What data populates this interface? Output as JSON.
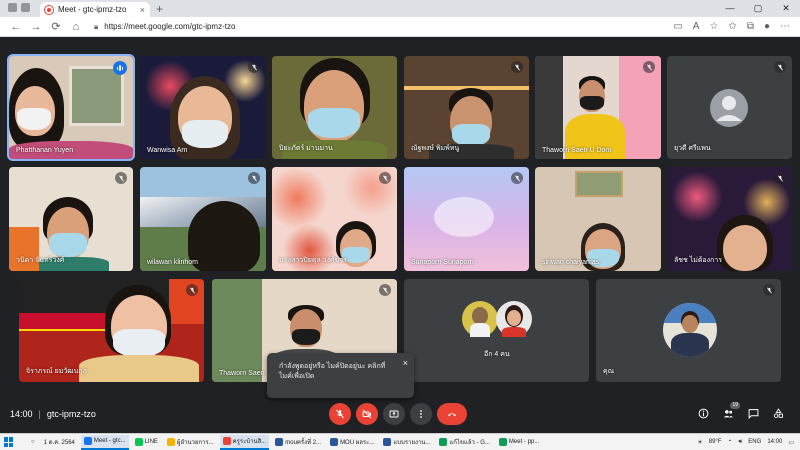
{
  "browser": {
    "tab_title": "Meet - gtc-ipmz-tzo",
    "url": "https://meet.google.com/gtc-ipmz-tzo"
  },
  "tiles": [
    {
      "name": "Phatthanan Yuyen",
      "speaking": true
    },
    {
      "name": "Wanwisa Am"
    },
    {
      "name": "ปิยะภัตร์ ม่านมาน"
    },
    {
      "name": "ณัฐพงษ์ พิมพ์หนู"
    },
    {
      "name": "Thaworn Saen U Dom"
    },
    {
      "name": "ยุวดี ศรีแพน",
      "initial": ""
    },
    {
      "name": "วนิดา จันทร์วงศ์"
    },
    {
      "name": "wilawan klinhom"
    },
    {
      "name": "นางสาวปิยตุล วงศ์ขจร"
    },
    {
      "name": "Sunaporn Sunaporn"
    },
    {
      "name": "siriwan chaiyamas"
    },
    {
      "name": "ลัชช ไม่ต้องการ"
    },
    {
      "name": "จิราภรณ์ ยมวัฒนกุล"
    },
    {
      "name": "Thaworn Saen"
    },
    {
      "name": "อีก 4 คน"
    },
    {
      "name": "คุณ"
    }
  ],
  "toast": {
    "text": "กำลังพูดอยู่หรือ ไมค์ปิดอยู่นะ คลิกที่ไมค์เพื่อเปิด",
    "close": "×"
  },
  "controls": {
    "time": "14:00",
    "separator": "|",
    "meeting_code": "gtc-ipmz-tzo",
    "participants_badge": "19"
  },
  "taskbar": {
    "date": "1 ต.ค. 2564",
    "items": [
      "Meet - gtc...",
      "LINE",
      "ผู้อำนวยการ...",
      "ครูระบ้านสิ...",
      "mouครั้งที่ 2...",
      "MOU ผลระ...",
      "แบบรายงาน...",
      "แก้ไขแล้ว - G...",
      "Meet - pp..."
    ],
    "weather": "89°F",
    "lang": "ENG",
    "clock": "14:00"
  }
}
